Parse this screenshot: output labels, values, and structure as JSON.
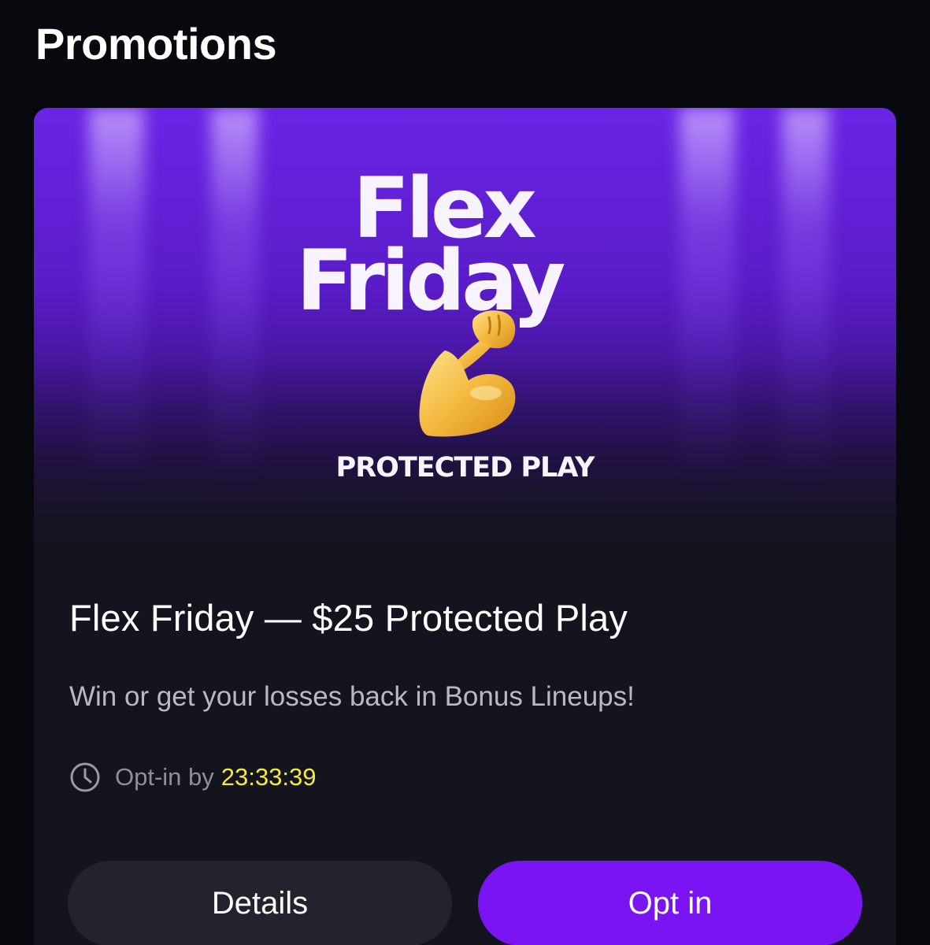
{
  "header": {
    "title": "Promotions"
  },
  "promotion": {
    "banner": {
      "headline_line1": "Flex",
      "headline_line2": "Friday",
      "subtitle": "PROTECTED PLAY",
      "icon": "flexed-biceps-icon"
    },
    "title": "Flex Friday — $25 Protected Play",
    "description": "Win or get your losses back in Bonus Lineups!",
    "optin": {
      "icon": "clock-icon",
      "label": "Opt-in by",
      "countdown": "23:33:39"
    },
    "buttons": {
      "details_label": "Details",
      "optin_label": "Opt in"
    }
  },
  "colors": {
    "background": "#08080f",
    "card": "#14141e",
    "accent": "#7a14f2",
    "countdown": "#f5ea3b",
    "banner_purple": "#5a1cc8"
  }
}
